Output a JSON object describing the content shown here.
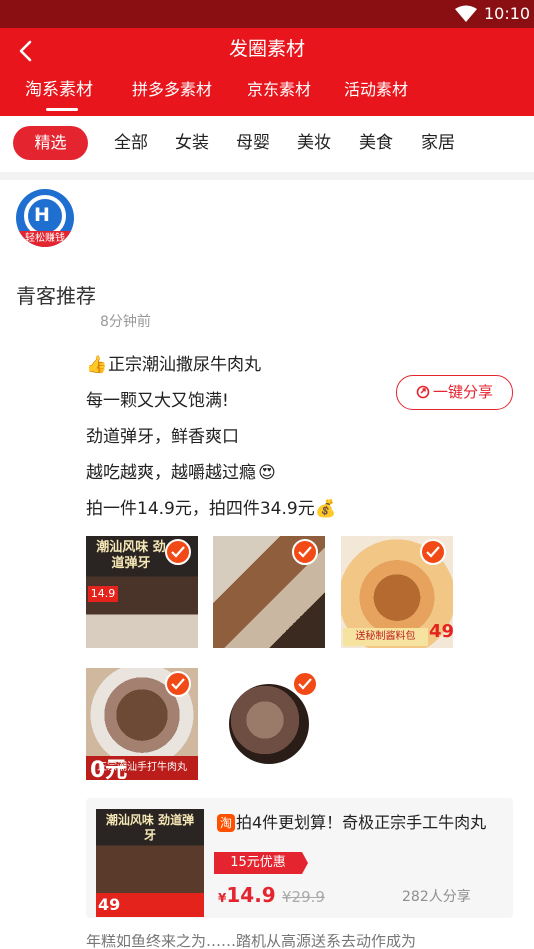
{
  "status_bar": {
    "time": "10:10"
  },
  "header": {
    "title": "发圈素材",
    "tabs": [
      "淘系素材",
      "拼多多素材",
      "京东素材",
      "活动素材"
    ],
    "active_tab": "淘系素材"
  },
  "categories": {
    "active": "精选",
    "items": [
      "全部",
      "女装",
      "母婴",
      "美妆",
      "美食",
      "家居"
    ]
  },
  "post": {
    "avatar_text": "轻松赚钱",
    "user_name": "青客推荐",
    "time": "8分钟前",
    "share_label": "一键分享",
    "lines": [
      "正宗潮汕撒尿牛肉丸",
      "每一颗又大又饱满!",
      "劲道弹牙，鲜香爽口",
      "越吃越爽，越嚼越过瘾",
      "拍一件14.9元，拍四件34.9元"
    ],
    "line_emojis": [
      "👍",
      "",
      "",
      "😍",
      "💰"
    ],
    "photos": {
      "p1_banner": "潮汕风味 劲道弹牙",
      "p1_price": "14.9",
      "p3_label": "送秘制酱料包",
      "p3_price": "49",
      "p4_zero": "0元",
      "p4_strip": "正宗潮汕手打牛肉丸"
    }
  },
  "product": {
    "thumb_banner": "潮汕风味 劲道弹牙",
    "thumb_price": "49",
    "platform_icon": "淘",
    "title": "拍4件更划算！奇极正宗手工牛肉丸",
    "coupon": "15元优惠",
    "currency": "¥",
    "price": "14.9",
    "original_price": "¥29.9",
    "share_count": "282人分享"
  },
  "next_post_snippet": "年糕如鱼终来之为……踏机从高源送系去动作成为"
}
